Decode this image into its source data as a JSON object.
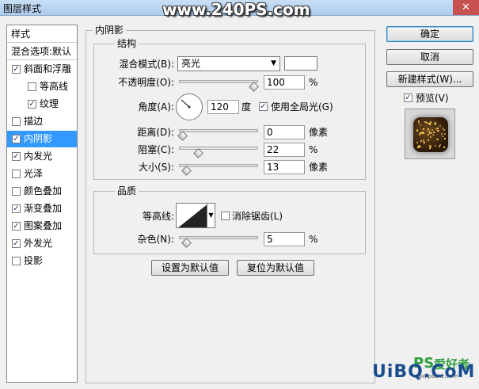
{
  "window": {
    "title": "图层样式",
    "watermark": "www.240PS.com",
    "close_glyph": "✕"
  },
  "style_list": {
    "items": [
      {
        "label": "样式",
        "type": "header"
      },
      {
        "label": "混合选项:默认",
        "type": "header"
      },
      {
        "label": "斜面和浮雕",
        "checked": true
      },
      {
        "label": "等高线",
        "checked": false,
        "indent": true
      },
      {
        "label": "纹理",
        "checked": true,
        "indent": true
      },
      {
        "label": "描边",
        "checked": false
      },
      {
        "label": "内阴影",
        "checked": true,
        "selected": true
      },
      {
        "label": "内发光",
        "checked": true
      },
      {
        "label": "光泽",
        "checked": false
      },
      {
        "label": "颜色叠加",
        "checked": false
      },
      {
        "label": "渐变叠加",
        "checked": true
      },
      {
        "label": "图案叠加",
        "checked": true
      },
      {
        "label": "外发光",
        "checked": true
      },
      {
        "label": "投影",
        "checked": false
      }
    ]
  },
  "panel": {
    "title": "内阴影",
    "structure": {
      "title": "结构",
      "blend_mode_label": "混合模式(B):",
      "blend_mode_value": "亮光",
      "opacity_label": "不透明度(O):",
      "opacity_value": "100",
      "opacity_unit": "%",
      "opacity_fraction": 1.0,
      "angle_label": "角度(A):",
      "angle_value": "120",
      "angle_unit": "度",
      "use_global_light_label": "使用全局光(G)",
      "use_global_light_checked": true,
      "distance_label": "距离(D):",
      "distance_value": "0",
      "distance_unit": "像素",
      "distance_fraction": 0.0,
      "choke_label": "阻塞(C):",
      "choke_value": "22",
      "choke_unit": "%",
      "choke_fraction": 0.22,
      "size_label": "大小(S):",
      "size_value": "13",
      "size_unit": "像素",
      "size_fraction": 0.05
    },
    "quality": {
      "title": "品质",
      "contour_label": "等高线:",
      "anti_alias_label": "消除锯齿(L)",
      "anti_alias_checked": false,
      "noise_label": "杂色(N):",
      "noise_value": "5",
      "noise_unit": "%",
      "noise_fraction": 0.05
    },
    "make_default_label": "设置为默认值",
    "reset_default_label": "复位为默认值"
  },
  "right": {
    "ok_label": "确定",
    "cancel_label": "取消",
    "new_style_label": "新建样式(W)...",
    "preview_label": "预览(V)",
    "preview_checked": true
  },
  "footer": {
    "logo_ps": "PS",
    "logo_cn": "爱好者",
    "logo_url": "www.psahz.com",
    "logo_ubq": "UiBQ.CoM"
  },
  "colors": {
    "selected_bg": "#3399ff",
    "logo_green": "#2e9f3e",
    "logo_blue": "#1a4d8f"
  }
}
